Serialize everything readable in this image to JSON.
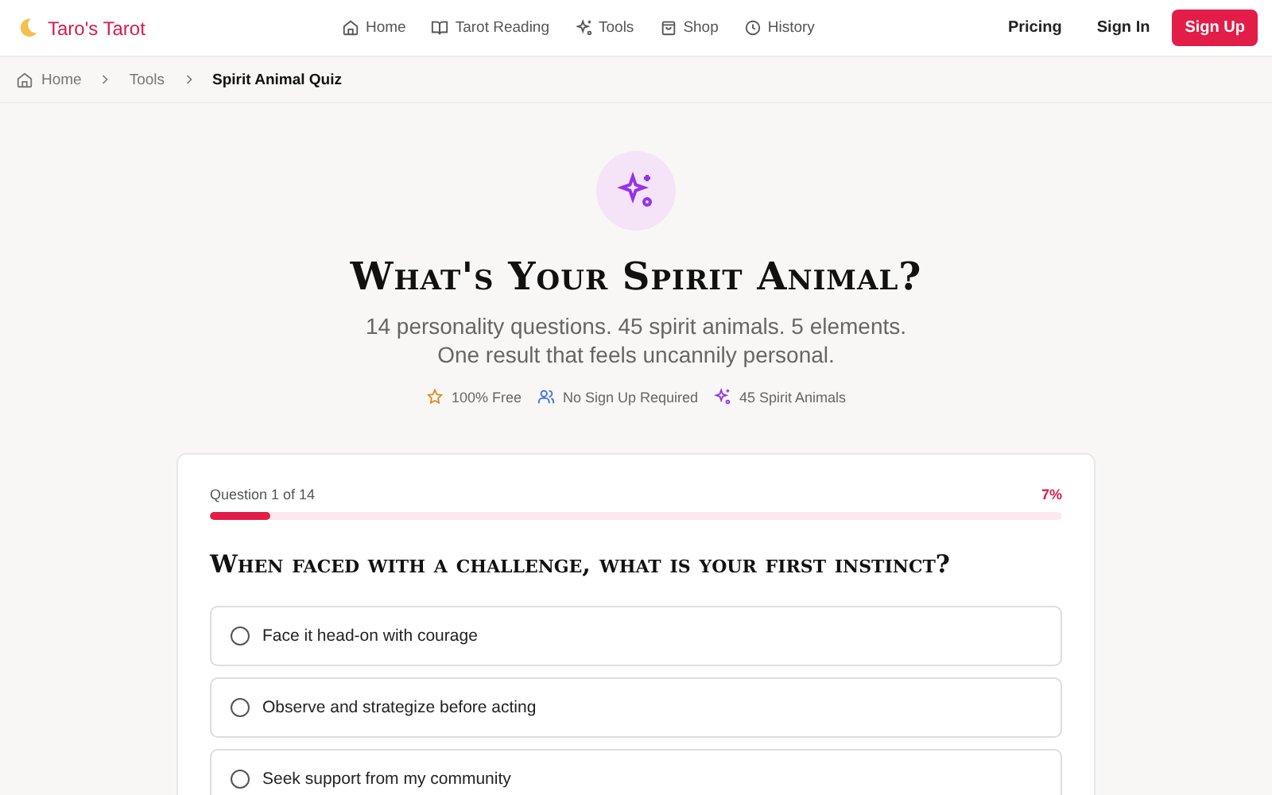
{
  "header": {
    "logo": "Taro's Tarot",
    "nav": [
      {
        "label": "Home"
      },
      {
        "label": "Tarot Reading"
      },
      {
        "label": "Tools"
      },
      {
        "label": "Shop"
      },
      {
        "label": "History"
      }
    ],
    "actions": [
      {
        "label": "Pricing",
        "kind": "link"
      },
      {
        "label": "Sign In",
        "kind": "link"
      },
      {
        "label": "Sign Up",
        "kind": "primary"
      }
    ]
  },
  "breadcrumb": [
    {
      "label": "Home",
      "current": false
    },
    {
      "label": "Tools",
      "current": false
    },
    {
      "label": "Spirit Animal Quiz",
      "current": true
    }
  ],
  "hero": {
    "title": "What's Your Spirit Animal?",
    "subtitle_lines": [
      "14 personality questions. 45 spirit animals. 5 elements.",
      "One result that feels uncannily personal."
    ],
    "badges": [
      {
        "label": "100% Free"
      },
      {
        "label": "No Sign Up Required"
      },
      {
        "label": "45 Spirit Animals"
      }
    ]
  },
  "quiz": {
    "progress_label": "Question 1 of 14",
    "percent": "7%",
    "level": 0.07,
    "question": "When faced with a challenge, what is your first instinct?",
    "options": [
      {
        "label": "Face it head-on with courage",
        "selected": false
      },
      {
        "label": "Observe and strategize before acting",
        "selected": false
      },
      {
        "label": "Seek support from my community",
        "selected": false
      }
    ]
  }
}
